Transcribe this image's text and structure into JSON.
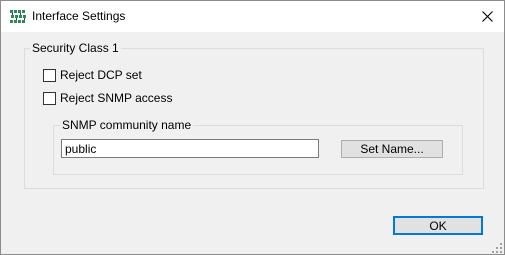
{
  "window": {
    "title": "Interface Settings",
    "app_icon": "network-grid-icon",
    "close_icon": "close-icon"
  },
  "security_group": {
    "label": "Security Class 1",
    "checkboxes": [
      {
        "label": "Reject DCP set",
        "checked": false
      },
      {
        "label": "Reject SNMP access",
        "checked": false
      }
    ]
  },
  "snmp_group": {
    "label": "SNMP community name",
    "input_value": "public",
    "set_name_label": "Set Name..."
  },
  "footer": {
    "ok_label": "OK"
  },
  "colors": {
    "window_bg": "#f0f0f0",
    "titlebar_bg": "#ffffff",
    "button_bg": "#e1e1e1",
    "default_button_border": "#0078d7",
    "app_icon_color": "#2e8b57"
  }
}
